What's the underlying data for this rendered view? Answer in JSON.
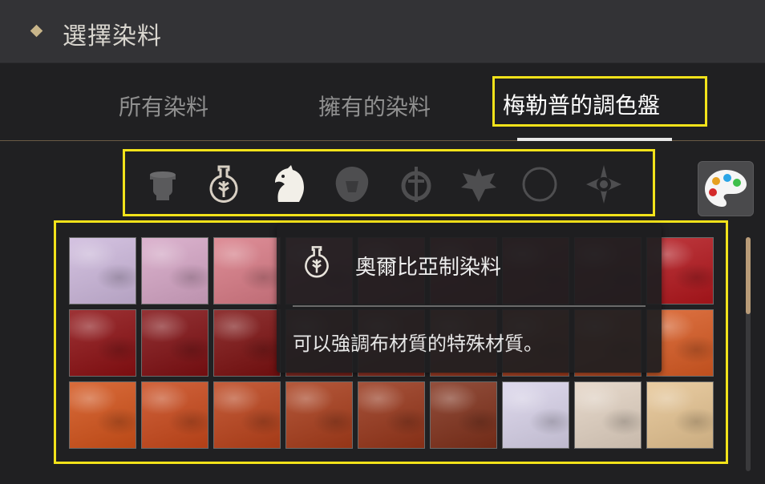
{
  "header": {
    "title": "選擇染料"
  },
  "tabs": [
    {
      "label": "所有染料",
      "selected": false
    },
    {
      "label": "擁有的染料",
      "selected": false
    },
    {
      "label": "梅勒普的調色盤",
      "selected": true
    }
  ],
  "faction_icons": [
    {
      "name": "pot-icon",
      "selected": false
    },
    {
      "name": "orbe-flask-icon",
      "selected": false
    },
    {
      "name": "horse-head-icon",
      "selected": true
    },
    {
      "name": "lion-head-icon",
      "selected": false
    },
    {
      "name": "sun-sword-icon",
      "selected": false
    },
    {
      "name": "eagle-crest-icon",
      "selected": false
    },
    {
      "name": "crescent-moon-icon",
      "selected": false
    },
    {
      "name": "star-eye-icon",
      "selected": false
    }
  ],
  "palette_button": {
    "icon": "palette-icon"
  },
  "swatches": [
    [
      "#cdb8dc",
      "#d6a6c6",
      "#d97b86",
      "#b8465a",
      "#a02835",
      "#9a1a22",
      "#8f141a",
      "#8a1216",
      "#b3161c"
    ],
    [
      "#8c0f12",
      "#800f12",
      "#7c1010",
      "#88251c",
      "#982e1e",
      "#a8391e",
      "#b9431f",
      "#c94d20",
      "#d85a22"
    ],
    [
      "#d35219",
      "#c9481a",
      "#bb421a",
      "#a83c1a",
      "#973519",
      "#80301a",
      "#d9d3ea",
      "#e3d3c3",
      "#e6c492"
    ]
  ],
  "tooltip": {
    "name": "奧爾比亞制染料",
    "icon": "orbe-flask-icon",
    "description": "可以強調布材質的特殊材質。"
  },
  "highlight_color": "#f2e21a"
}
